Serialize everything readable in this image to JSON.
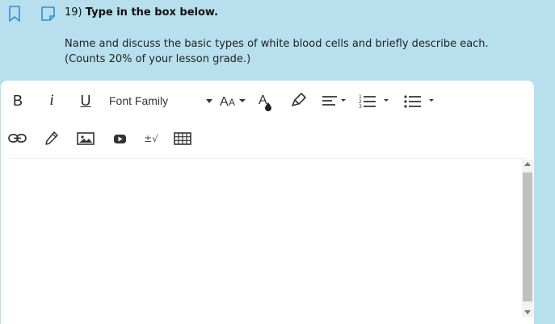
{
  "question": {
    "number": "19)",
    "title": "Type in the box below.",
    "prompt_line1": "Name and discuss the basic types of white blood cells and briefly describe each.",
    "prompt_line2": "(Counts 20% of your lesson grade.)"
  },
  "icons": {
    "bookmark": "bookmark-icon",
    "note": "note-icon"
  },
  "toolbar": {
    "bold_label": "B",
    "italic_label": "i",
    "underline_label": "U",
    "font_family_label": "Font Family",
    "math_label": "±√"
  },
  "editor": {
    "value": ""
  },
  "colors": {
    "page_background": "#b7dfee",
    "icon_blue": "#2f8fd6",
    "editor_background": "#ffffff"
  }
}
